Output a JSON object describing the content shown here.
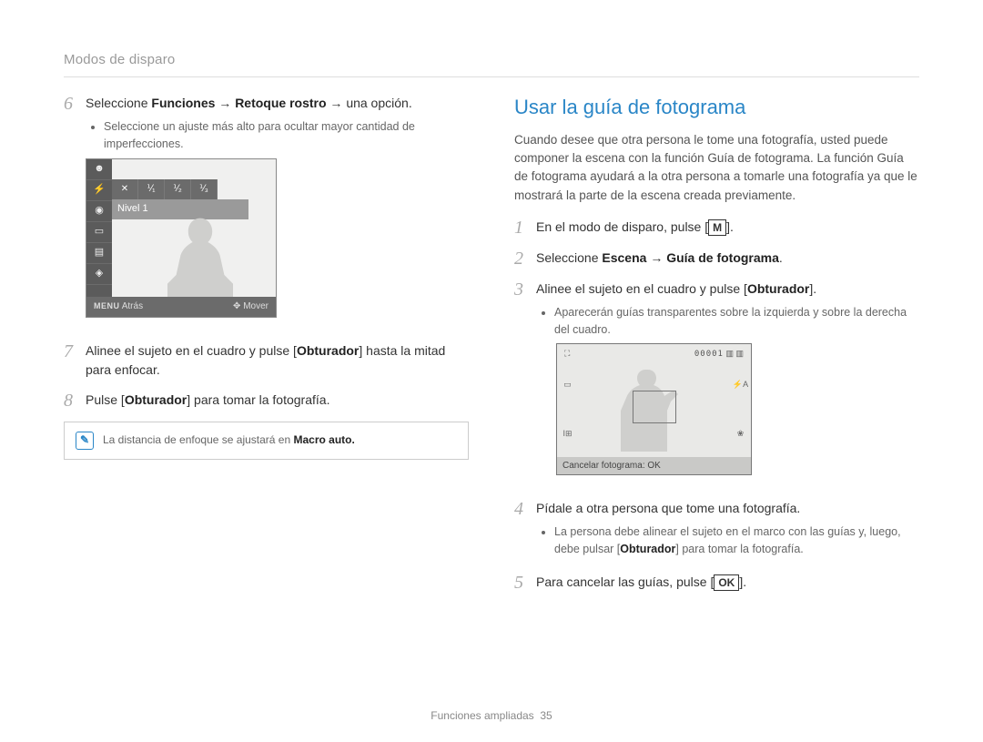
{
  "breadcrumb": "Modos de disparo",
  "left": {
    "step6": {
      "num": "6",
      "text_prefix": "Seleccione ",
      "bold1": "Funciones",
      "arrow1": " → ",
      "bold2": "Retoque rostro",
      "arrow2": " → ",
      "text_suffix": "una opción.",
      "bullet1": "Seleccione un ajuste más alto para ocultar mayor cantidad de imperfecciones."
    },
    "lcd1": {
      "level_label": "Nivel 1",
      "menu_label": "MENU",
      "back_label": "Atrás",
      "nav_icon": "✥",
      "move_label": "Mover",
      "frac_cells": [
        "⅟₁",
        "⅟₂",
        "⅟₃"
      ]
    },
    "step7": {
      "num": "7",
      "pre": "Alinee el sujeto en el cuadro y pulse [",
      "bold": "Obturador",
      "post": "] hasta la mitad para enfocar."
    },
    "step8": {
      "num": "8",
      "pre": "Pulse [",
      "bold": "Obturador",
      "post": "] para tomar la fotografía."
    },
    "note": {
      "pre": "La distancia de enfoque se ajustará en ",
      "bold": "Macro auto.",
      "icon_text": "✎"
    }
  },
  "right": {
    "title": "Usar la guía de fotograma",
    "intro": "Cuando desee que otra persona le tome una fotografía, usted puede componer la escena con la función Guía de fotograma. La función Guía de fotograma ayudará a la otra persona a tomarle una fotografía ya que le mostrará la parte de la escena creada previamente.",
    "step1": {
      "num": "1",
      "pre": "En el modo de disparo, pulse [",
      "mode_glyph": "M",
      "post": "]."
    },
    "step2": {
      "num": "2",
      "pre": "Seleccione ",
      "bold1": "Escena",
      "arrow": " → ",
      "bold2": "Guía de fotograma",
      "post": "."
    },
    "step3": {
      "num": "3",
      "pre": "Alinee el sujeto en el cuadro y pulse [",
      "bold": "Obturador",
      "post": "].",
      "bullet1": "Aparecerán guías transparentes sobre la izquierda y sobre la derecha del cuadro."
    },
    "lcd2": {
      "counter": "00001",
      "footer": "Cancelar fotograma: OK"
    },
    "step4": {
      "num": "4",
      "text": "Pídale a otra persona que tome una fotografía.",
      "bullet_pre": "La persona debe alinear el sujeto en el marco con las guías y, luego, debe pulsar [",
      "bullet_bold": "Obturador",
      "bullet_post": "] para tomar la fotografía."
    },
    "step5": {
      "num": "5",
      "pre": "Para cancelar las guías, pulse [",
      "mode_glyph": "OK",
      "post": "]."
    }
  },
  "footer": {
    "section": "Funciones ampliadas",
    "page": "35"
  }
}
